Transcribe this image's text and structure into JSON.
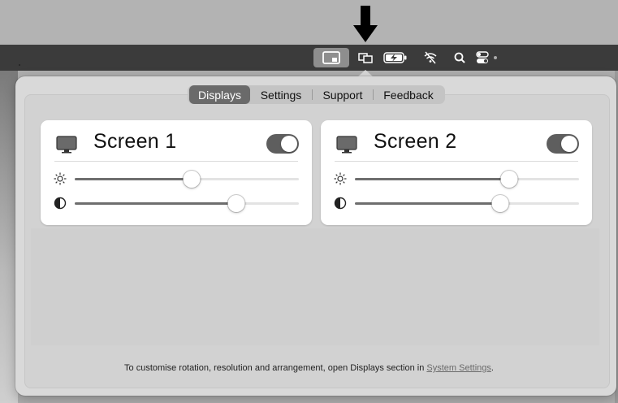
{
  "menubar": {
    "icons": [
      "display-manager-icon",
      "displays-icon",
      "battery-charging-icon",
      "wifi-off-icon",
      "search-icon",
      "control-center-icon"
    ]
  },
  "tabs": [
    {
      "label": "Displays",
      "active": true
    },
    {
      "label": "Settings",
      "active": false
    },
    {
      "label": "Support",
      "active": false
    },
    {
      "label": "Feedback",
      "active": false
    }
  ],
  "screens": [
    {
      "name": "Screen 1",
      "enabled": true,
      "brightness": 0.52,
      "contrast": 0.72
    },
    {
      "name": "Screen 2",
      "enabled": true,
      "brightness": 0.69,
      "contrast": 0.65
    }
  ],
  "footer": {
    "text": "To customise rotation, resolution and arrangement, open Displays section in ",
    "link": "System Settings",
    "suffix": "."
  },
  "colors": {
    "menubar": "#3b3b3b",
    "popover": "#d9d9d9",
    "active_tab": "#6a6a6a",
    "toggle_on": "#5e5e5e",
    "slider_fill": "#6e6e6e"
  }
}
